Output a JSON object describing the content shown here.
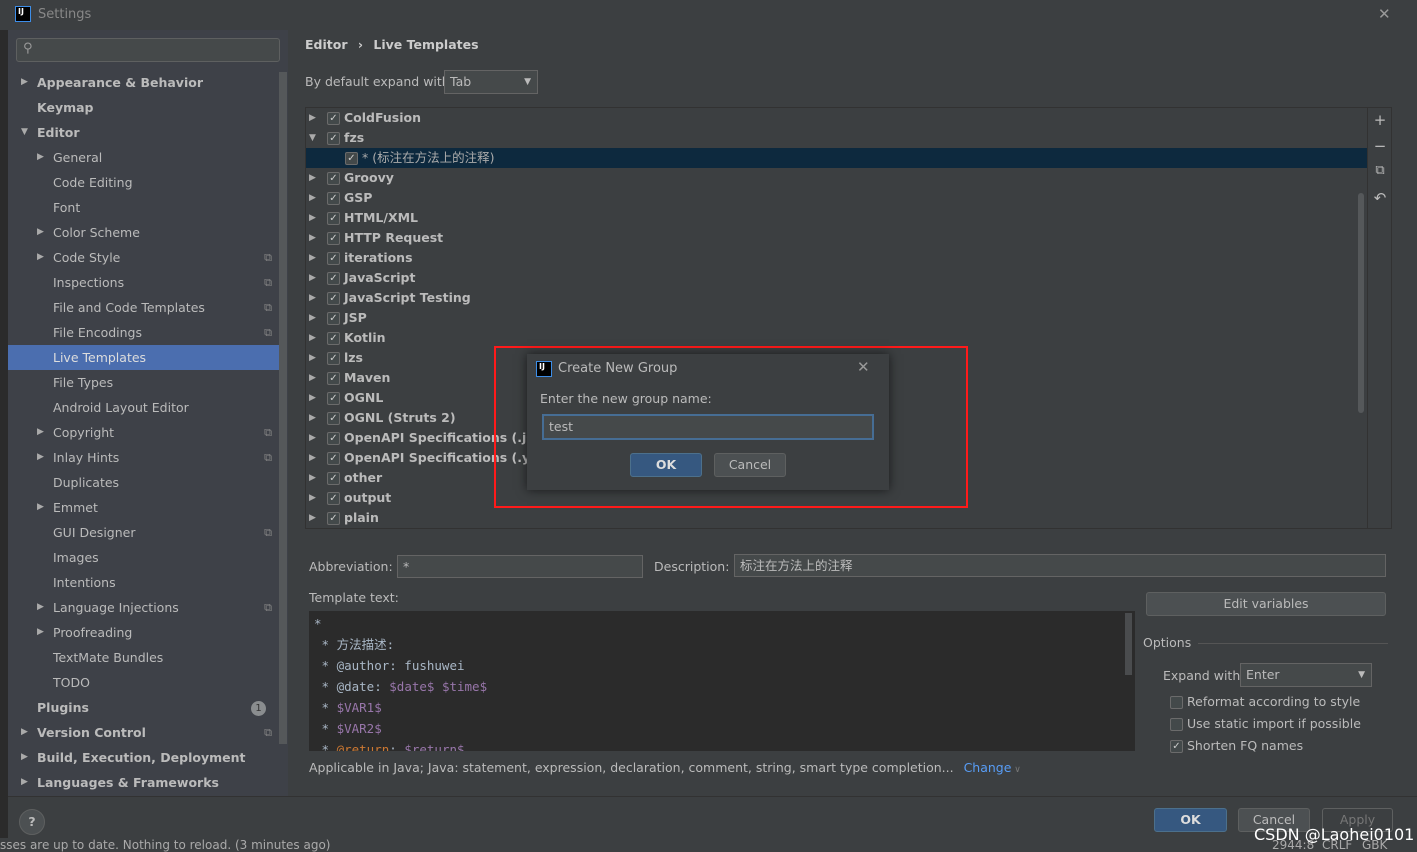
{
  "window": {
    "title": "Settings",
    "close": "✕"
  },
  "sidebar": {
    "search_placeholder": "",
    "items": [
      {
        "label": "Appearance & Behavior",
        "level": 0,
        "arrow": "right",
        "bold": true
      },
      {
        "label": "Keymap",
        "level": 0,
        "bold": true
      },
      {
        "label": "Editor",
        "level": 0,
        "arrow": "down",
        "bold": true
      },
      {
        "label": "General",
        "level": 1,
        "arrow": "right"
      },
      {
        "label": "Code Editing",
        "level": 1
      },
      {
        "label": "Font",
        "level": 1
      },
      {
        "label": "Color Scheme",
        "level": 1,
        "arrow": "right"
      },
      {
        "label": "Code Style",
        "level": 1,
        "arrow": "right",
        "copy": true
      },
      {
        "label": "Inspections",
        "level": 1,
        "copy": true
      },
      {
        "label": "File and Code Templates",
        "level": 1,
        "copy": true
      },
      {
        "label": "File Encodings",
        "level": 1,
        "copy": true
      },
      {
        "label": "Live Templates",
        "level": 1,
        "selected": true
      },
      {
        "label": "File Types",
        "level": 1
      },
      {
        "label": "Android Layout Editor",
        "level": 1
      },
      {
        "label": "Copyright",
        "level": 1,
        "arrow": "right",
        "copy": true
      },
      {
        "label": "Inlay Hints",
        "level": 1,
        "arrow": "right",
        "copy": true
      },
      {
        "label": "Duplicates",
        "level": 1
      },
      {
        "label": "Emmet",
        "level": 1,
        "arrow": "right"
      },
      {
        "label": "GUI Designer",
        "level": 1,
        "copy": true
      },
      {
        "label": "Images",
        "level": 1
      },
      {
        "label": "Intentions",
        "level": 1
      },
      {
        "label": "Language Injections",
        "level": 1,
        "arrow": "right",
        "copy": true
      },
      {
        "label": "Proofreading",
        "level": 1,
        "arrow": "right"
      },
      {
        "label": "TextMate Bundles",
        "level": 1
      },
      {
        "label": "TODO",
        "level": 1
      },
      {
        "label": "Plugins",
        "level": 0,
        "bold": true,
        "badge": "1"
      },
      {
        "label": "Version Control",
        "level": 0,
        "arrow": "right",
        "bold": true,
        "copy": true
      },
      {
        "label": "Build, Execution, Deployment",
        "level": 0,
        "arrow": "right",
        "bold": true
      },
      {
        "label": "Languages & Frameworks",
        "level": 0,
        "arrow": "right",
        "bold": true
      }
    ]
  },
  "breadcrumb": {
    "parent": "Editor",
    "sep": "›",
    "current": "Live Templates"
  },
  "expand_default": {
    "label": "By default expand with",
    "value": "Tab"
  },
  "tree": [
    {
      "label": "ColdFusion",
      "arrow": "right"
    },
    {
      "label": "fzs",
      "arrow": "down"
    },
    {
      "label": "* (标注在方法上的注释)",
      "child": true,
      "selected": true
    },
    {
      "label": "Groovy",
      "arrow": "right"
    },
    {
      "label": "GSP",
      "arrow": "right"
    },
    {
      "label": "HTML/XML",
      "arrow": "right"
    },
    {
      "label": "HTTP Request",
      "arrow": "right"
    },
    {
      "label": "iterations",
      "arrow": "right"
    },
    {
      "label": "JavaScript",
      "arrow": "right"
    },
    {
      "label": "JavaScript Testing",
      "arrow": "right"
    },
    {
      "label": "JSP",
      "arrow": "right"
    },
    {
      "label": "Kotlin",
      "arrow": "right"
    },
    {
      "label": "lzs",
      "arrow": "right"
    },
    {
      "label": "Maven",
      "arrow": "right"
    },
    {
      "label": "OGNL",
      "arrow": "right"
    },
    {
      "label": "OGNL (Struts 2)",
      "arrow": "right"
    },
    {
      "label": "OpenAPI Specifications (.json)",
      "arrow": "right"
    },
    {
      "label": "OpenAPI Specifications (.yaml)",
      "arrow": "right"
    },
    {
      "label": "other",
      "arrow": "right"
    },
    {
      "label": "output",
      "arrow": "right"
    },
    {
      "label": "plain",
      "arrow": "right"
    }
  ],
  "toolbar": {
    "add": "+",
    "remove": "−",
    "copy": "⧉",
    "revert": "↶"
  },
  "details": {
    "abbreviation_label": "Abbreviation:",
    "abbreviation": "*",
    "description_label": "Description:",
    "description": "标注在方法上的注释",
    "template_label": "Template text:",
    "edit_variables": "Edit variables",
    "template_lines": [
      [
        {
          "t": "*"
        }
      ],
      [
        {
          "t": " * 方法描述:"
        }
      ],
      [
        {
          "t": " * @author: fushuwei"
        }
      ],
      [
        {
          "t": " * @date: "
        },
        {
          "t": "$date$ $time$",
          "c": "var"
        }
      ],
      [
        {
          "t": " * "
        },
        {
          "t": "$VAR1$",
          "c": "var"
        }
      ],
      [
        {
          "t": " * "
        },
        {
          "t": "$VAR2$",
          "c": "var"
        }
      ],
      [
        {
          "t": " * "
        },
        {
          "t": "@return",
          "c": "tag"
        },
        {
          "t": ": "
        },
        {
          "t": "$return$",
          "c": "var"
        }
      ]
    ],
    "applicable": "Applicable in Java; Java: statement, expression, declaration, comment, string, smart type completion...",
    "change": "Change"
  },
  "options": {
    "title": "Options",
    "expand_label": "Expand with",
    "expand_value": "Enter",
    "reformat": {
      "label": "Reformat according to style",
      "checked": false
    },
    "static_import": {
      "label": "Use static import if possible",
      "checked": false
    },
    "shorten": {
      "label": "Shorten FQ names",
      "checked": true
    }
  },
  "dialog": {
    "title": "Create New Group",
    "prompt": "Enter the new group name:",
    "value": "test",
    "ok": "OK",
    "cancel": "Cancel"
  },
  "footer": {
    "help": "?",
    "ok": "OK",
    "cancel": "Cancel",
    "apply": "Apply"
  },
  "statusbar": {
    "message": "sses are up to date. Nothing to reload. (3 minutes ago)",
    "position": "2944:8",
    "line_sep": "CRLF",
    "encoding": "GBK"
  },
  "watermark": "CSDN @Laohei0101",
  "colors": {
    "selection": "#4b6eaf",
    "tree_selection": "#0d293e",
    "highlight_box": "#ff1a1a",
    "link": "#589df6"
  }
}
